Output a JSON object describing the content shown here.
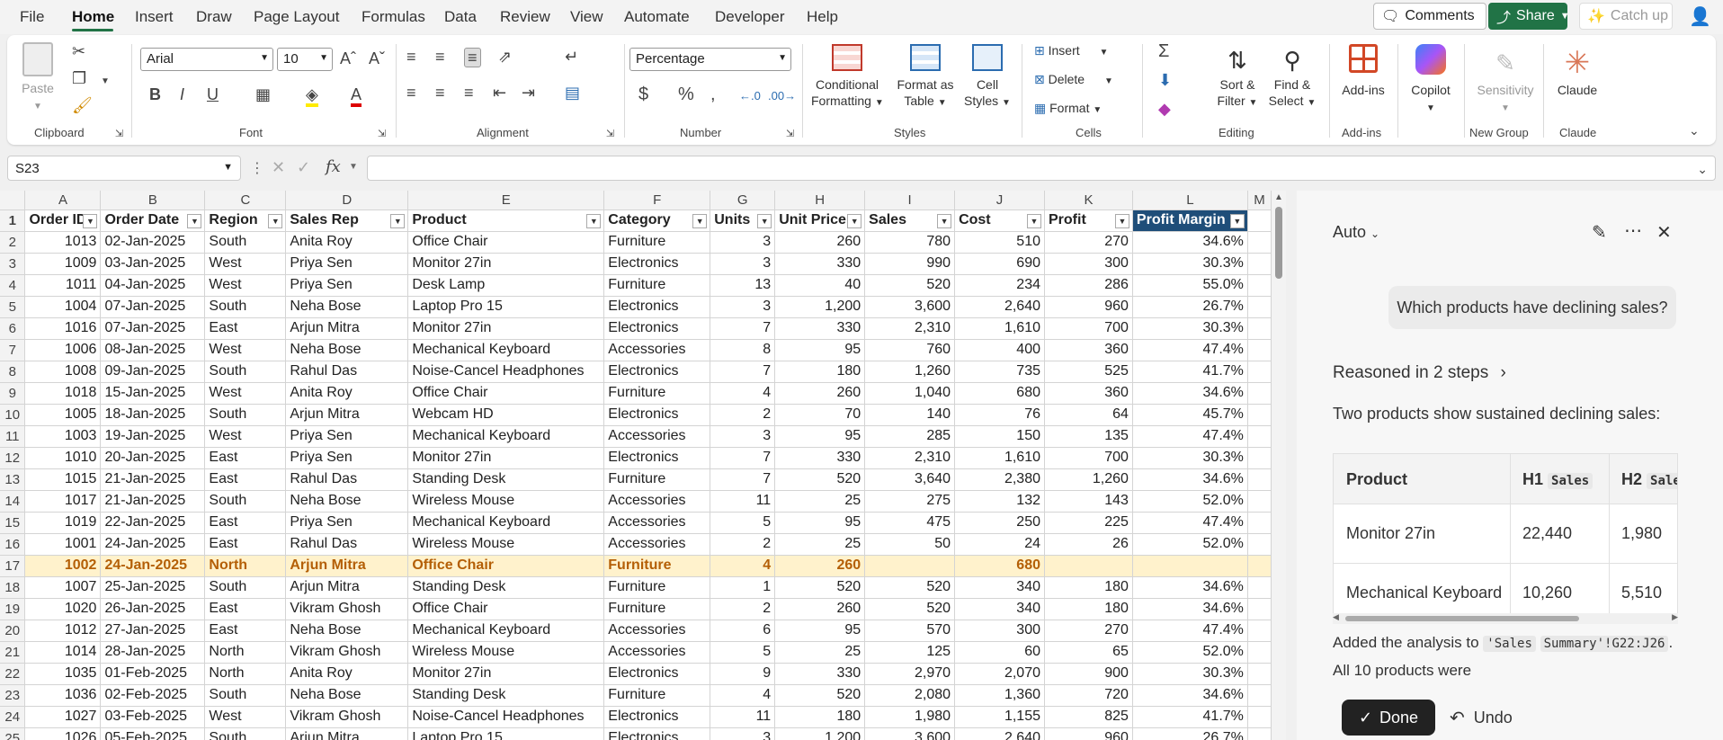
{
  "menu": {
    "file": "File",
    "home": "Home",
    "insert": "Insert",
    "draw": "Draw",
    "page_layout": "Page Layout",
    "formulas": "Formulas",
    "data": "Data",
    "review": "Review",
    "view": "View",
    "automate": "Automate",
    "developer": "Developer",
    "help": "Help"
  },
  "top": {
    "comments": "Comments",
    "share": "Share",
    "catch_up": "Catch up"
  },
  "ribbon": {
    "clipboard": {
      "paste": "Paste",
      "label": "Clipboard"
    },
    "font": {
      "name": "Arial",
      "size": "10",
      "label": "Font"
    },
    "alignment": {
      "label": "Alignment"
    },
    "number": {
      "format": "Percentage",
      "label": "Number"
    },
    "styles": {
      "cond1": "Conditional",
      "cond2": "Formatting",
      "fat1": "Format as",
      "fat2": "Table",
      "cs1": "Cell",
      "cs2": "Styles",
      "label": "Styles"
    },
    "cells": {
      "insert": "Insert",
      "delete": "Delete",
      "format": "Format",
      "label": "Cells"
    },
    "editing": {
      "sf1": "Sort &",
      "sf2": "Filter",
      "fs1": "Find &",
      "fs2": "Select",
      "label": "Editing"
    },
    "addins": {
      "btn": "Add-ins",
      "label": "Add-ins"
    },
    "copilot": {
      "btn": "Copilot"
    },
    "sensitivity": {
      "btn": "Sensitivity",
      "label": "New Group"
    },
    "claude": {
      "btn": "Claude",
      "label": "Claude"
    }
  },
  "formula_bar": {
    "cell_ref": "S23",
    "fx": "fx"
  },
  "columns": [
    "A",
    "B",
    "C",
    "D",
    "E",
    "F",
    "G",
    "H",
    "I",
    "J",
    "K",
    "L",
    "M"
  ],
  "headers": [
    "Order ID",
    "Order Date",
    "Region",
    "Sales Rep",
    "Product",
    "Category",
    "Units",
    "Unit Price",
    "Sales",
    "Cost",
    "Profit",
    "Profit Margin"
  ],
  "rows": [
    [
      "2",
      "1013",
      "02-Jan-2025",
      "South",
      "Anita Roy",
      "Office Chair",
      "Furniture",
      "3",
      "260",
      "780",
      "510",
      "270",
      "34.6%"
    ],
    [
      "3",
      "1009",
      "03-Jan-2025",
      "West",
      "Priya Sen",
      "Monitor 27in",
      "Electronics",
      "3",
      "330",
      "990",
      "690",
      "300",
      "30.3%"
    ],
    [
      "4",
      "1011",
      "04-Jan-2025",
      "West",
      "Priya Sen",
      "Desk Lamp",
      "Furniture",
      "13",
      "40",
      "520",
      "234",
      "286",
      "55.0%"
    ],
    [
      "5",
      "1004",
      "07-Jan-2025",
      "South",
      "Neha Bose",
      "Laptop Pro 15",
      "Electronics",
      "3",
      "1,200",
      "3,600",
      "2,640",
      "960",
      "26.7%"
    ],
    [
      "6",
      "1016",
      "07-Jan-2025",
      "East",
      "Arjun Mitra",
      "Monitor 27in",
      "Electronics",
      "7",
      "330",
      "2,310",
      "1,610",
      "700",
      "30.3%"
    ],
    [
      "7",
      "1006",
      "08-Jan-2025",
      "West",
      "Neha Bose",
      "Mechanical Keyboard",
      "Accessories",
      "8",
      "95",
      "760",
      "400",
      "360",
      "47.4%"
    ],
    [
      "8",
      "1008",
      "09-Jan-2025",
      "South",
      "Rahul Das",
      "Noise-Cancel Headphones",
      "Electronics",
      "7",
      "180",
      "1,260",
      "735",
      "525",
      "41.7%"
    ],
    [
      "9",
      "1018",
      "15-Jan-2025",
      "West",
      "Anita Roy",
      "Office Chair",
      "Furniture",
      "4",
      "260",
      "1,040",
      "680",
      "360",
      "34.6%"
    ],
    [
      "10",
      "1005",
      "18-Jan-2025",
      "South",
      "Arjun Mitra",
      "Webcam HD",
      "Electronics",
      "2",
      "70",
      "140",
      "76",
      "64",
      "45.7%"
    ],
    [
      "11",
      "1003",
      "19-Jan-2025",
      "West",
      "Priya Sen",
      "Mechanical Keyboard",
      "Accessories",
      "3",
      "95",
      "285",
      "150",
      "135",
      "47.4%"
    ],
    [
      "12",
      "1010",
      "20-Jan-2025",
      "East",
      "Priya Sen",
      "Monitor 27in",
      "Electronics",
      "7",
      "330",
      "2,310",
      "1,610",
      "700",
      "30.3%"
    ],
    [
      "13",
      "1015",
      "21-Jan-2025",
      "East",
      "Rahul Das",
      "Standing Desk",
      "Furniture",
      "7",
      "520",
      "3,640",
      "2,380",
      "1,260",
      "34.6%"
    ],
    [
      "14",
      "1017",
      "21-Jan-2025",
      "South",
      "Neha Bose",
      "Wireless Mouse",
      "Accessories",
      "11",
      "25",
      "275",
      "132",
      "143",
      "52.0%"
    ],
    [
      "15",
      "1019",
      "22-Jan-2025",
      "East",
      "Priya Sen",
      "Mechanical Keyboard",
      "Accessories",
      "5",
      "95",
      "475",
      "250",
      "225",
      "47.4%"
    ],
    [
      "16",
      "1001",
      "24-Jan-2025",
      "East",
      "Rahul Das",
      "Wireless Mouse",
      "Accessories",
      "2",
      "25",
      "50",
      "24",
      "26",
      "52.0%"
    ],
    [
      "17",
      "1002",
      "24-Jan-2025",
      "North",
      "Arjun Mitra",
      "Office Chair",
      "Furniture",
      "4",
      "260",
      "",
      "680",
      "",
      ""
    ],
    [
      "18",
      "1007",
      "25-Jan-2025",
      "South",
      "Arjun Mitra",
      "Standing Desk",
      "Furniture",
      "1",
      "520",
      "520",
      "340",
      "180",
      "34.6%"
    ],
    [
      "19",
      "1020",
      "26-Jan-2025",
      "East",
      "Vikram Ghosh",
      "Office Chair",
      "Furniture",
      "2",
      "260",
      "520",
      "340",
      "180",
      "34.6%"
    ],
    [
      "20",
      "1012",
      "27-Jan-2025",
      "East",
      "Neha Bose",
      "Mechanical Keyboard",
      "Accessories",
      "6",
      "95",
      "570",
      "300",
      "270",
      "47.4%"
    ],
    [
      "21",
      "1014",
      "28-Jan-2025",
      "North",
      "Vikram Ghosh",
      "Wireless Mouse",
      "Accessories",
      "5",
      "25",
      "125",
      "60",
      "65",
      "52.0%"
    ],
    [
      "22",
      "1035",
      "01-Feb-2025",
      "North",
      "Anita Roy",
      "Monitor 27in",
      "Electronics",
      "9",
      "330",
      "2,970",
      "2,070",
      "900",
      "30.3%"
    ],
    [
      "23",
      "1036",
      "02-Feb-2025",
      "South",
      "Neha Bose",
      "Standing Desk",
      "Furniture",
      "4",
      "520",
      "2,080",
      "1,360",
      "720",
      "34.6%"
    ],
    [
      "24",
      "1027",
      "03-Feb-2025",
      "West",
      "Vikram Ghosh",
      "Noise-Cancel Headphones",
      "Electronics",
      "11",
      "180",
      "1,980",
      "1,155",
      "825",
      "41.7%"
    ],
    [
      "25",
      "1026",
      "05-Feb-2025",
      "South",
      "Arjun Mitra",
      "Laptop Pro 15",
      "Electronics",
      "3",
      "1,200",
      "3,600",
      "2,640",
      "960",
      "26.7%"
    ]
  ],
  "pane": {
    "mode": "Auto",
    "question": "Which products have declining sales?",
    "reasoned": "Reasoned in 2 steps",
    "intro": "Two products show sustained declining sales:",
    "table": {
      "h_product": "Product",
      "h_h1": "H1",
      "h_h1_tag": "Sales",
      "h_h2": "H2",
      "h_h2_tag": "Sales",
      "rows": [
        {
          "product": "Monitor 27in",
          "h1": "22,440",
          "h2": "1,980"
        },
        {
          "product": "Mechanical Keyboard",
          "h1": "10,260",
          "h2": "5,510"
        }
      ]
    },
    "added_1": "Added the analysis to",
    "added_code1": "'Sales",
    "added_code2": "Summary'!G22:J26",
    "added_2": ". All 10 products were",
    "done": "Done",
    "undo": "Undo"
  }
}
